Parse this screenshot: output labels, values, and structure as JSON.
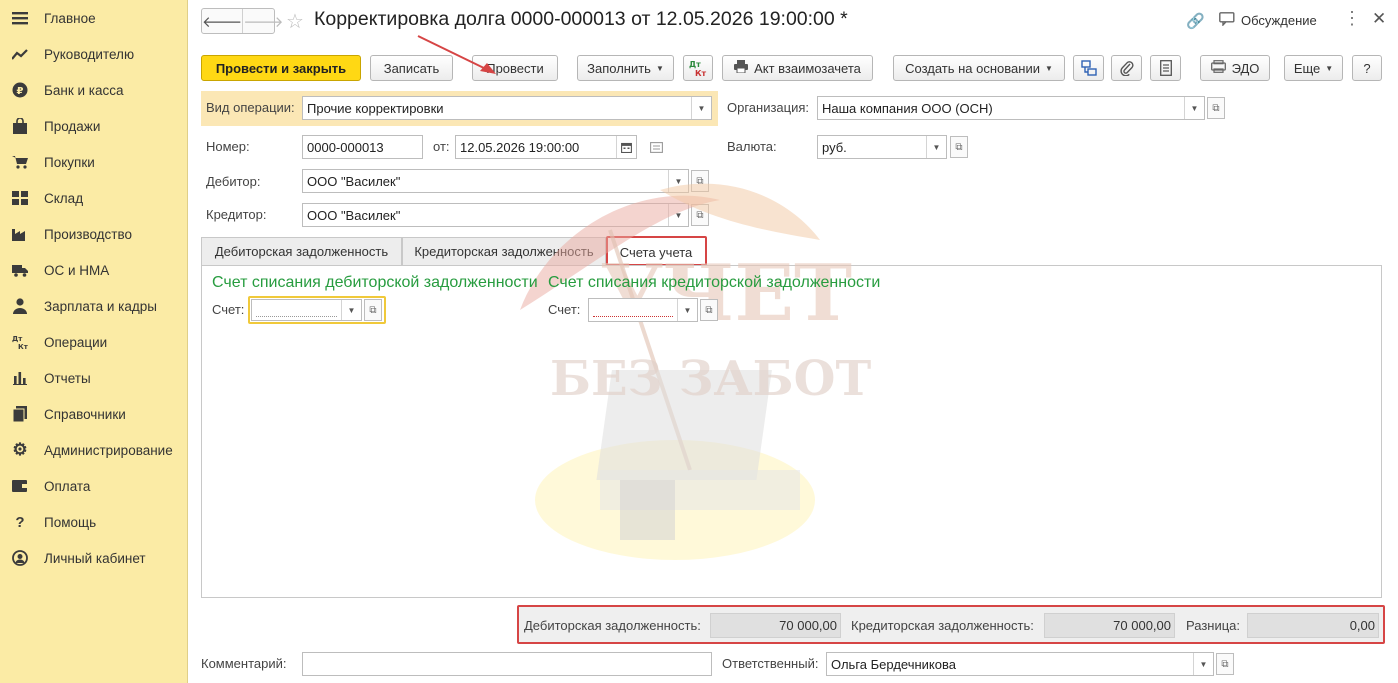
{
  "sidebar": {
    "items": [
      {
        "label": "Главное",
        "icon": "menu-icon"
      },
      {
        "label": "Руководителю",
        "icon": "trend-icon"
      },
      {
        "label": "Банк и касса",
        "icon": "ruble-icon"
      },
      {
        "label": "Продажи",
        "icon": "bag-icon"
      },
      {
        "label": "Покупки",
        "icon": "cart-icon"
      },
      {
        "label": "Склад",
        "icon": "warehouse-icon"
      },
      {
        "label": "Производство",
        "icon": "factory-icon"
      },
      {
        "label": "ОС и НМА",
        "icon": "truck-icon"
      },
      {
        "label": "Зарплата и кадры",
        "icon": "person-icon"
      },
      {
        "label": "Операции",
        "icon": "dt-kt-icon"
      },
      {
        "label": "Отчеты",
        "icon": "bar-chart-icon"
      },
      {
        "label": "Справочники",
        "icon": "books-icon"
      },
      {
        "label": "Администрирование",
        "icon": "gear-icon"
      },
      {
        "label": "Оплата",
        "icon": "wallet-icon"
      },
      {
        "label": "Помощь",
        "icon": "question-icon"
      },
      {
        "label": "Личный кабинет",
        "icon": "user-circle-icon"
      }
    ]
  },
  "header": {
    "title": "Корректировка долга 0000-000013 от 12.05.2026 19:00:00 *",
    "discuss_label": "Обсуждение"
  },
  "toolbar": {
    "post_close": "Провести и закрыть",
    "save": "Записать",
    "post": "Провести",
    "fill": "Заполнить",
    "dtkt": "Дт Кт",
    "act": "Акт взаимозачета",
    "create_based": "Создать на основании",
    "edo": "ЭДО",
    "more": "Еще",
    "help": "?"
  },
  "form": {
    "op_type_label": "Вид операции:",
    "op_type_value": "Прочие корректировки",
    "org_label": "Организация:",
    "org_value": "Наша компания ООО (ОСН)",
    "number_label": "Номер:",
    "number_value": "0000-000013",
    "date_label": "от:",
    "date_value": "12.05.2026 19:00:00",
    "currency_label": "Валюта:",
    "currency_value": "руб.",
    "debtor_label": "Дебитор:",
    "debtor_value": "ООО \"Василек\"",
    "creditor_label": "Кредитор:",
    "creditor_value": "ООО \"Василек\""
  },
  "tabs": [
    {
      "label": "Дебиторская задолженность"
    },
    {
      "label": "Кредиторская задолженность"
    },
    {
      "label": "Счета учета"
    }
  ],
  "accounts": {
    "debit_title": "Счет списания дебиторской задолженности",
    "credit_title": "Счет списания кредиторской задолженности",
    "account_label": "Счет:"
  },
  "watermark": {
    "line1": "УЧЕТ",
    "line2": "БЕЗ ЗАБОТ"
  },
  "totals": {
    "debit_label": "Дебиторская задолженность:",
    "debit_value": "70 000,00",
    "credit_label": "Кредиторская задолженность:",
    "credit_value": "70 000,00",
    "diff_label": "Разница:",
    "diff_value": "0,00"
  },
  "footer": {
    "comment_label": "Комментарий:",
    "comment_value": "",
    "responsible_label": "Ответственный:",
    "responsible_value": "Ольга Бердечникова"
  },
  "colors": {
    "sidebar_bg": "#fbeba5",
    "primary_button": "#ffd814",
    "section_title": "#279c3f",
    "highlight": "#d64545"
  }
}
